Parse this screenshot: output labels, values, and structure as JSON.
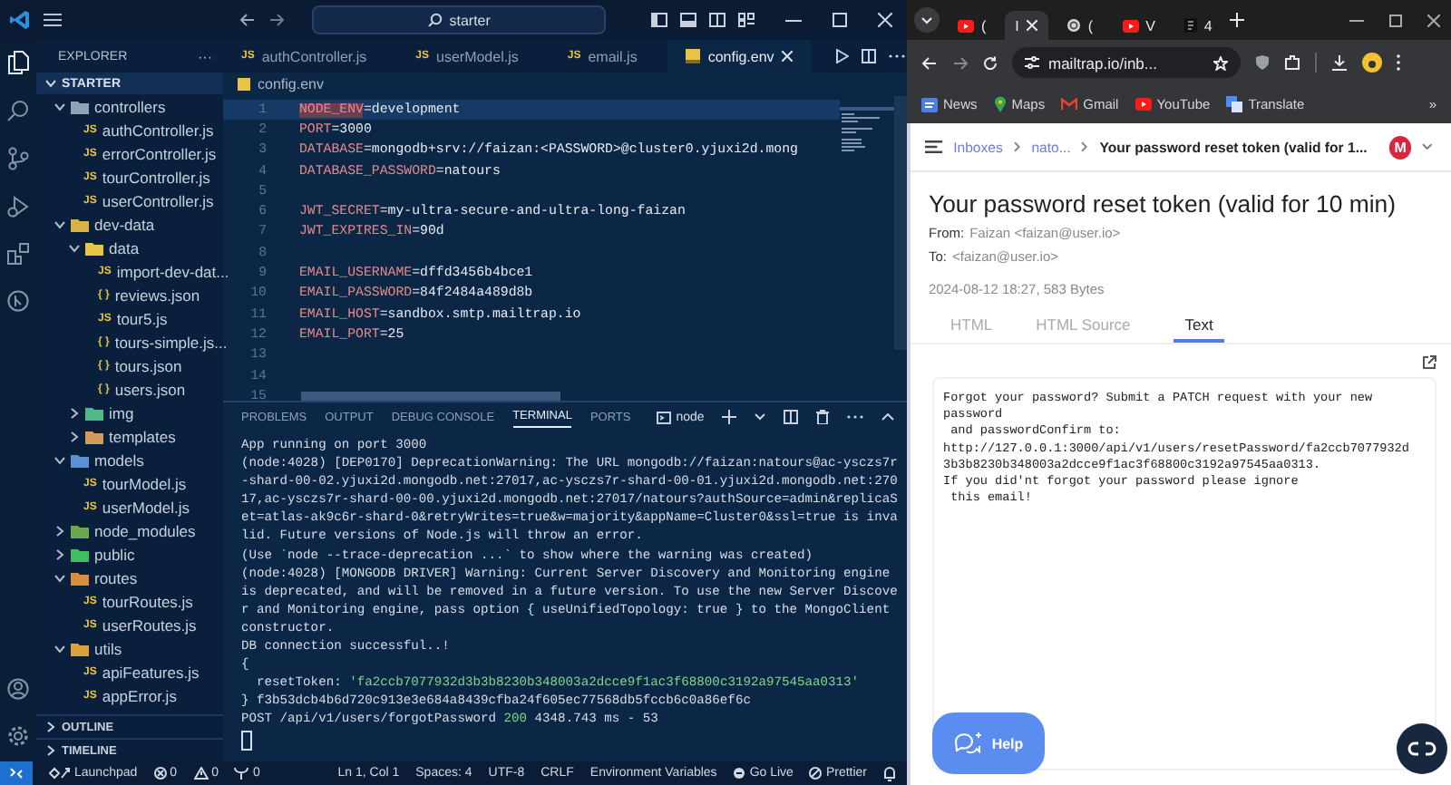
{
  "vscode": {
    "search": "starter",
    "explorer": {
      "title": "EXPLORER",
      "more": "···"
    },
    "root": {
      "label": "STARTER",
      "expanded": true
    },
    "tree": [
      {
        "label": "controllers",
        "kind": "folder",
        "color": "#8fa3b8",
        "expanded": true,
        "children": [
          {
            "label": "authController.js",
            "kind": "js",
            "badge": "JS"
          },
          {
            "label": "errorController.js",
            "kind": "js",
            "badge": "JS"
          },
          {
            "label": "tourController.js",
            "kind": "js",
            "badge": "JS"
          },
          {
            "label": "userController.js",
            "kind": "js",
            "badge": "JS"
          }
        ]
      },
      {
        "label": "dev-data",
        "kind": "folder",
        "color": "#d9b24a",
        "expanded": true,
        "children": [
          {
            "label": "data",
            "kind": "folder",
            "color": "#e8c547",
            "expanded": true,
            "children": [
              {
                "label": "import-dev-dat...",
                "kind": "js",
                "badge": "JS"
              },
              {
                "label": "reviews.json",
                "kind": "json",
                "badge": "{ }"
              },
              {
                "label": "tour5.js",
                "kind": "js",
                "badge": "JS"
              },
              {
                "label": "tours-simple.js...",
                "kind": "json",
                "badge": "{ }"
              },
              {
                "label": "tours.json",
                "kind": "json",
                "badge": "{ }"
              },
              {
                "label": "users.json",
                "kind": "json",
                "badge": "{ }"
              }
            ]
          },
          {
            "label": "img",
            "kind": "folder",
            "color": "#4fb98a",
            "expanded": false
          },
          {
            "label": "templates",
            "kind": "folder",
            "color": "#d49a5a",
            "expanded": false
          }
        ]
      },
      {
        "label": "models",
        "kind": "folder",
        "color": "#5b8fd6",
        "expanded": true,
        "children": [
          {
            "label": "tourModel.js",
            "kind": "js",
            "badge": "JS"
          },
          {
            "label": "userModel.js",
            "kind": "js",
            "badge": "JS"
          }
        ]
      },
      {
        "label": "node_modules",
        "kind": "folder",
        "color": "#6aa84f",
        "expanded": false
      },
      {
        "label": "public",
        "kind": "folder",
        "color": "#3fbf5f",
        "expanded": false
      },
      {
        "label": "routes",
        "kind": "folder",
        "color": "#d98c3a",
        "expanded": true,
        "children": [
          {
            "label": "tourRoutes.js",
            "kind": "js",
            "badge": "JS"
          },
          {
            "label": "userRoutes.js",
            "kind": "js",
            "badge": "JS"
          }
        ]
      },
      {
        "label": "utils",
        "kind": "folder",
        "color": "#d9a23a",
        "expanded": true,
        "children": [
          {
            "label": "apiFeatures.js",
            "kind": "js",
            "badge": "JS"
          },
          {
            "label": "appError.js",
            "kind": "js",
            "badge": "JS"
          }
        ]
      }
    ],
    "sections": [
      {
        "label": "OUTLINE",
        "expanded": false
      },
      {
        "label": "TIMELINE",
        "expanded": false
      }
    ],
    "tabs": [
      {
        "label": "authController.js",
        "kind": "js",
        "badge": "JS",
        "selected": false
      },
      {
        "label": "userModel.js",
        "kind": "js",
        "badge": "JS",
        "selected": false
      },
      {
        "label": "email.js",
        "kind": "js",
        "badge": "JS",
        "selected": false
      },
      {
        "label": "config.env",
        "kind": "env",
        "selected": true
      }
    ],
    "breadcrumb": "config.env",
    "code": [
      {
        "number": "1",
        "key": "NODE_ENV",
        "value": "=development",
        "current": true
      },
      {
        "number": "2",
        "key": "PORT",
        "value": "=3000",
        "current": false
      },
      {
        "number": "3",
        "key": "DATABASE",
        "value": "=mongodb+srv://faizan:<PASSWORD>@cluster0.yjuxi2d.mong",
        "current": false
      },
      {
        "number": "4",
        "key": "DATABASE_PASSWORD",
        "value": "=natours",
        "current": false
      },
      {
        "number": "5",
        "current": false
      },
      {
        "number": "6",
        "key": "JWT_SECRET",
        "value": "=my-ultra-secure-and-ultra-long-faizan",
        "current": false
      },
      {
        "number": "7",
        "key": "JWT_EXPIRES_IN",
        "value": "=90d",
        "current": false
      },
      {
        "number": "8",
        "current": false
      },
      {
        "number": "9",
        "key": "EMAIL_USERNAME",
        "value": "=dffd3456b4bce1",
        "current": false
      },
      {
        "number": "10",
        "key": "EMAIL_PASSWORD",
        "value": "=84f2484a489d8b",
        "current": false
      },
      {
        "number": "11",
        "key": "EMAIL_HOST",
        "value": "=sandbox.smtp.mailtrap.io",
        "current": false
      },
      {
        "number": "12",
        "key": "EMAIL_PORT",
        "value": "=25",
        "current": false
      },
      {
        "number": "13",
        "current": false
      },
      {
        "number": "14",
        "current": false
      },
      {
        "number": "15",
        "current": false
      }
    ],
    "panel_tabs": [
      {
        "label": "PROBLEMS",
        "selected": false
      },
      {
        "label": "OUTPUT",
        "selected": false
      },
      {
        "label": "DEBUG CONSOLE",
        "selected": false
      },
      {
        "label": "TERMINAL",
        "selected": true
      },
      {
        "label": "PORTS",
        "selected": false
      }
    ],
    "terminal_name": "node",
    "terminal": [
      {
        "kind": "plain",
        "text": "App running on port 3000"
      },
      {
        "kind": "plain",
        "text": "(node:4028) [DEP0170] DeprecationWarning: The URL mongodb://faizan:natours@ac-ysczs7r"
      },
      {
        "kind": "plain",
        "text": "-shard-00-02.yjuxi2d.mongodb.net:27017,ac-ysczs7r-shard-00-01.yjuxi2d.mongodb.net:270"
      },
      {
        "kind": "plain",
        "text": "17,ac-ysczs7r-shard-00-00.yjuxi2d.mongodb.net:27017/natours?authSource=admin&replicaS"
      },
      {
        "kind": "plain",
        "text": "et=atlas-ak9c6r-shard-0&retryWrites=true&w=majority&appName=Cluster0&ssl=true is inva"
      },
      {
        "kind": "plain",
        "text": "lid. Future versions of Node.js will throw an error."
      },
      {
        "kind": "plain",
        "text": "(Use `node --trace-deprecation ...` to show where the warning was created)"
      },
      {
        "kind": "plain",
        "text": "(node:4028) [MONGODB DRIVER] Warning: Current Server Discovery and Monitoring engine"
      },
      {
        "kind": "plain",
        "text": "is deprecated, and will be removed in a future version. To use the new Server Discove"
      },
      {
        "kind": "plain",
        "text": "r and Monitoring engine, pass option { useUnifiedTopology: true } to the MongoClient"
      },
      {
        "kind": "plain",
        "text": "constructor."
      },
      {
        "kind": "plain",
        "text": "DB connection successful..!"
      },
      {
        "kind": "plain",
        "text": "{"
      },
      {
        "kind": "token",
        "text": "  resetToken: ",
        "value": "'fa2ccb7077932d3b3b8230b348003a2dcce9f1ac3f68800c3192a97545aa0313'"
      },
      {
        "kind": "plain",
        "text": "} f3b53dcb4b6d720c913e3e684a8439cfba24f605ec77568db5fccb6c0a86ef6c"
      },
      {
        "kind": "request",
        "text": "POST /api/v1/users/forgotPassword ",
        "status": "200",
        "tail": " 4348.743 ms - 53"
      }
    ],
    "status_left": [
      {
        "kind": "launchpad",
        "text": "Launchpad"
      },
      {
        "kind": "errors",
        "text": "0"
      },
      {
        "kind": "warnings",
        "text": "0"
      },
      {
        "kind": "ports",
        "text": "0"
      }
    ],
    "status_right": [
      {
        "kind": "plain",
        "text": "Ln 1, Col 1"
      },
      {
        "kind": "plain",
        "text": "Spaces: 4"
      },
      {
        "kind": "plain",
        "text": "UTF-8"
      },
      {
        "kind": "plain",
        "text": "CRLF"
      },
      {
        "kind": "plain",
        "text": "Environment Variables"
      },
      {
        "kind": "golive",
        "text": "Go Live"
      },
      {
        "kind": "prettier",
        "text": "Prettier"
      }
    ]
  },
  "browser": {
    "tabs": [
      {
        "kind": "video",
        "title": "(",
        "selected": false
      },
      {
        "kind": "none",
        "title": "I",
        "selected": true
      },
      {
        "kind": "knot",
        "title": "(",
        "selected": false
      },
      {
        "kind": "video",
        "title": "V",
        "selected": false
      },
      {
        "kind": "dark",
        "title": "4",
        "selected": false
      }
    ],
    "url": "mailtrap.io/inb...",
    "bookmarks": [
      {
        "kind": "news",
        "label": "News"
      },
      {
        "kind": "maps",
        "label": "Maps"
      },
      {
        "kind": "mail",
        "label": "Gmail"
      },
      {
        "kind": "video",
        "label": "YouTube"
      },
      {
        "kind": "translate",
        "label": "Translate"
      }
    ],
    "bookmarks_more": "»",
    "crumbs": [
      {
        "kind": "link",
        "text": "Inboxes"
      },
      {
        "kind": "link",
        "text": "nato..."
      },
      {
        "kind": "current",
        "text": "Your password reset token (valid for 1..."
      }
    ],
    "avatar": "M",
    "subject": "Your password reset token (valid for 10 min)",
    "from_label": "From:",
    "from": "Faizan <faizan@user.io>",
    "to_label": "To:",
    "to": "<faizan@user.io>",
    "meta": "2024-08-12 18:27, 583 Bytes",
    "views": [
      {
        "label": "HTML",
        "selected": false
      },
      {
        "label": "HTML Source",
        "selected": false
      },
      {
        "label": "Text",
        "selected": true
      }
    ],
    "body": [
      "Forgot your password? Submit a PATCH request with your new",
      "password",
      " and passwordConfirm to:",
      "http://127.0.0.1:3000/api/v1/users/resetPassword/fa2ccb7077932d",
      "3b3b8230b348003a2dcce9f1ac3f68800c3192a97545aa0313.",
      "If you did'nt forgot your password please ignore",
      " this email!"
    ],
    "help": "Help"
  }
}
